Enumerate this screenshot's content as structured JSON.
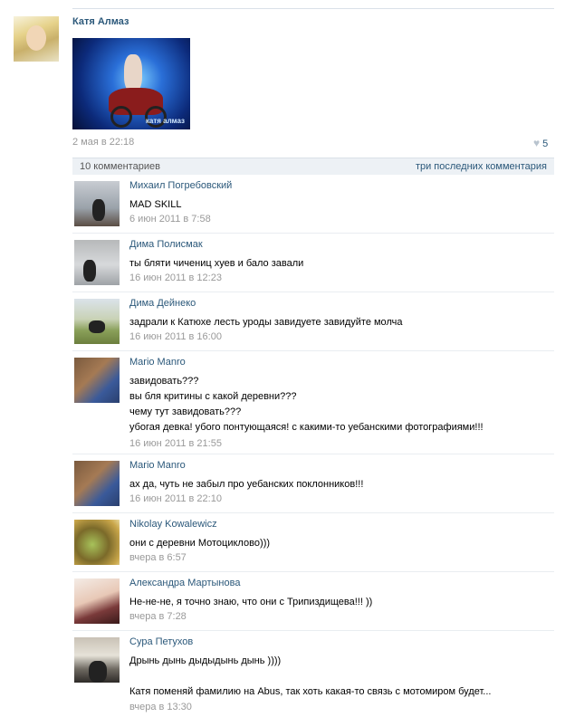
{
  "post": {
    "author": "Катя Алмаз",
    "photo_caption": "катя алмаз",
    "date": "2 мая в 22:18",
    "likes": "5"
  },
  "comments_bar": {
    "count_label": "10 комментариев",
    "last_label": "три последних комментария"
  },
  "replies": [
    {
      "author": "Михаил Погребовский",
      "text": [
        "MAD SKILL"
      ],
      "date": "6 июн 2011 в 7:58"
    },
    {
      "author": "Дима Полисмак",
      "text": [
        "ты бляти чичениц хуев и бало завали"
      ],
      "date": "16 июн 2011 в 12:23"
    },
    {
      "author": "Дима Дейнеко",
      "text": [
        "задрали к Катюхе лесть уроды завидуете завидуйте молча"
      ],
      "date": "16 июн 2011 в 16:00"
    },
    {
      "author": "Mario Manro",
      "text": [
        "завидовать???",
        "вы бля критины с какой деревни???",
        "чему тут завидовать???",
        "убогая девка! убого понтующаяся! с какими-то уебанскими фотографиями!!!"
      ],
      "date": "16 июн 2011 в 21:55"
    },
    {
      "author": "Mario Manro",
      "text": [
        "ах да, чуть не забыл про уебанских поклонников!!!"
      ],
      "date": "16 июн 2011 в 22:10"
    },
    {
      "author": "Nikolay Kowalewicz",
      "text": [
        "они с деревни Мотоцикловo)))"
      ],
      "date": "вчера в 6:57"
    },
    {
      "author": "Александра Мартынова",
      "text": [
        "Не-не-не, я точно знаю, что они с Трипиздищева!!! ))"
      ],
      "date": "вчера в 7:28"
    },
    {
      "author": "Сура Петухов",
      "text": [
        "Дрынь дынь дыдыдынь дынь ))))",
        "",
        "Катя поменяй фамилию на Abus, так хоть какая-то связь с мотомиром будет..."
      ],
      "date": "вчера в 13:30"
    }
  ]
}
